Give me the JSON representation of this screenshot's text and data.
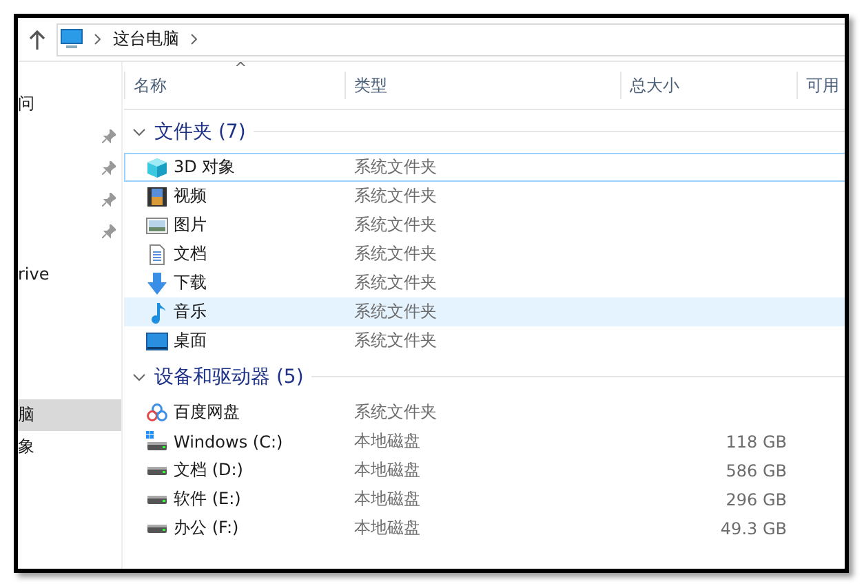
{
  "address_bar": {
    "path": [
      "这台电脑"
    ]
  },
  "nav_pane": {
    "items": [
      {
        "label": "问",
        "pinned": false,
        "selected": false
      },
      {
        "pinned": true,
        "selected": false
      },
      {
        "pinned": true,
        "selected": false
      },
      {
        "pinned": true,
        "selected": false
      },
      {
        "pinned": true,
        "selected": false
      },
      {
        "label": "rive",
        "pinned": false,
        "selected": false
      },
      {
        "label": "脑",
        "pinned": false,
        "selected": true
      },
      {
        "label": "象",
        "pinned": false,
        "selected": false
      }
    ]
  },
  "table": {
    "sort_indicator": "^",
    "columns": [
      "名称",
      "类型",
      "总大小",
      "可用"
    ]
  },
  "groups": [
    {
      "title": "文件夹 (7)",
      "expanded": true,
      "items": [
        {
          "kind": "cube",
          "name": "3D 对象",
          "type": "系统文件夹",
          "focused": true,
          "selected": false
        },
        {
          "kind": "video",
          "name": "视频",
          "type": "系统文件夹",
          "focused": false,
          "selected": false
        },
        {
          "kind": "pictures",
          "name": "图片",
          "type": "系统文件夹",
          "focused": false,
          "selected": false
        },
        {
          "kind": "documents",
          "name": "文档",
          "type": "系统文件夹",
          "focused": false,
          "selected": false
        },
        {
          "kind": "downloads",
          "name": "下载",
          "type": "系统文件夹",
          "focused": false,
          "selected": false
        },
        {
          "kind": "music",
          "name": "音乐",
          "type": "系统文件夹",
          "focused": false,
          "selected": true
        },
        {
          "kind": "desktop",
          "name": "桌面",
          "type": "系统文件夹",
          "focused": false,
          "selected": false
        }
      ]
    },
    {
      "title": "设备和驱动器 (5)",
      "expanded": true,
      "items": [
        {
          "kind": "cloud",
          "name": "百度网盘",
          "type": "系统文件夹",
          "focused": false,
          "selected": false
        },
        {
          "kind": "systemdrive",
          "name": "Windows (C:)",
          "type": "本地磁盘",
          "size": "118 GB",
          "focused": false,
          "selected": false
        },
        {
          "kind": "drive",
          "name": "文档 (D:)",
          "type": "本地磁盘",
          "size": "586 GB",
          "focused": false,
          "selected": false
        },
        {
          "kind": "drive",
          "name": "软件 (E:)",
          "type": "本地磁盘",
          "size": "296 GB",
          "focused": false,
          "selected": false
        },
        {
          "kind": "drive",
          "name": "办公 (F:)",
          "type": "本地磁盘",
          "size": "49.3 GB",
          "focused": false,
          "selected": false
        }
      ]
    }
  ]
}
